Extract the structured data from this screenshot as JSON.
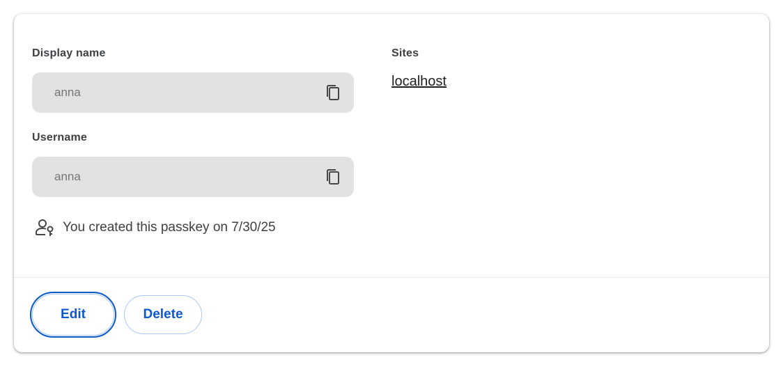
{
  "display_name": {
    "label": "Display name",
    "value": "anna"
  },
  "username": {
    "label": "Username",
    "value": "anna"
  },
  "sites": {
    "label": "Sites",
    "link": "localhost"
  },
  "created": {
    "text": "You created this passkey on 7/30/25"
  },
  "actions": {
    "edit_label": "Edit",
    "delete_label": "Delete"
  },
  "icons": {
    "copy": "copy-icon",
    "person_key": "person-key-icon"
  },
  "colors": {
    "accent": "#0b57d0",
    "field_bg": "#e1e3e1",
    "button_border": "#a8c7fa"
  }
}
